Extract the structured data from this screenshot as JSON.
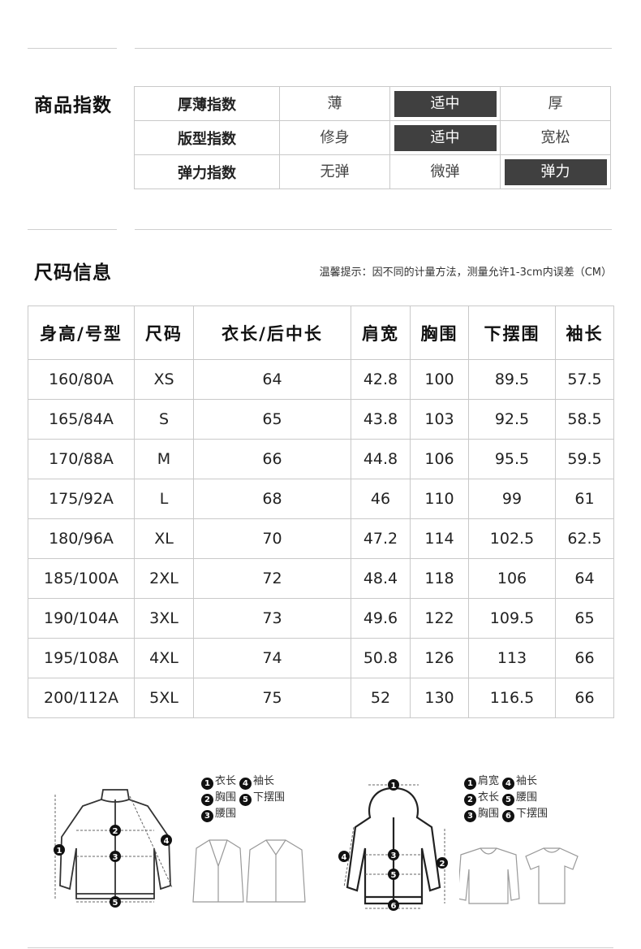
{
  "product_index": {
    "title": "商品指数",
    "rows": [
      {
        "label": "厚薄指数",
        "options": [
          "薄",
          "适中",
          "厚"
        ],
        "selected": 1
      },
      {
        "label": "版型指数",
        "options": [
          "修身",
          "适中",
          "宽松"
        ],
        "selected": 1
      },
      {
        "label": "弹力指数",
        "options": [
          "无弹",
          "微弹",
          "弹力"
        ],
        "selected": 2
      }
    ]
  },
  "size_info": {
    "title": "尺码信息",
    "note": "温馨提示：因不同的计量方法，测量允许1-3cm内误差（CM）",
    "headers": [
      "身高/号型",
      "尺码",
      "衣长/后中长",
      "肩宽",
      "胸围",
      "下摆围",
      "袖长"
    ],
    "rows": [
      [
        "160/80A",
        "XS",
        "64",
        "42.8",
        "100",
        "89.5",
        "57.5"
      ],
      [
        "165/84A",
        "S",
        "65",
        "43.8",
        "103",
        "92.5",
        "58.5"
      ],
      [
        "170/88A",
        "M",
        "66",
        "44.8",
        "106",
        "95.5",
        "59.5"
      ],
      [
        "175/92A",
        "L",
        "68",
        "46",
        "110",
        "99",
        "61"
      ],
      [
        "180/96A",
        "XL",
        "70",
        "47.2",
        "114",
        "102.5",
        "62.5"
      ],
      [
        "185/100A",
        "2XL",
        "72",
        "48.4",
        "118",
        "106",
        "64"
      ],
      [
        "190/104A",
        "3XL",
        "73",
        "49.6",
        "122",
        "109.5",
        "65"
      ],
      [
        "195/108A",
        "4XL",
        "74",
        "50.8",
        "126",
        "113",
        "66"
      ],
      [
        "200/112A",
        "5XL",
        "75",
        "52",
        "130",
        "116.5",
        "66"
      ]
    ]
  },
  "legend_left": [
    {
      "n": "1",
      "label": "衣长"
    },
    {
      "n": "4",
      "label": "袖长"
    },
    {
      "n": "2",
      "label": "胸围"
    },
    {
      "n": "5",
      "label": "下摆围"
    },
    {
      "n": "3",
      "label": "腰围"
    }
  ],
  "legend_right": [
    {
      "n": "1",
      "label": "肩宽"
    },
    {
      "n": "4",
      "label": "袖长"
    },
    {
      "n": "2",
      "label": "衣长"
    },
    {
      "n": "5",
      "label": "腰围"
    },
    {
      "n": "3",
      "label": "胸围"
    },
    {
      "n": "6",
      "label": "下摆围"
    }
  ],
  "colors": {
    "selected_bg": "#404040",
    "border": "#c9c9c9"
  }
}
